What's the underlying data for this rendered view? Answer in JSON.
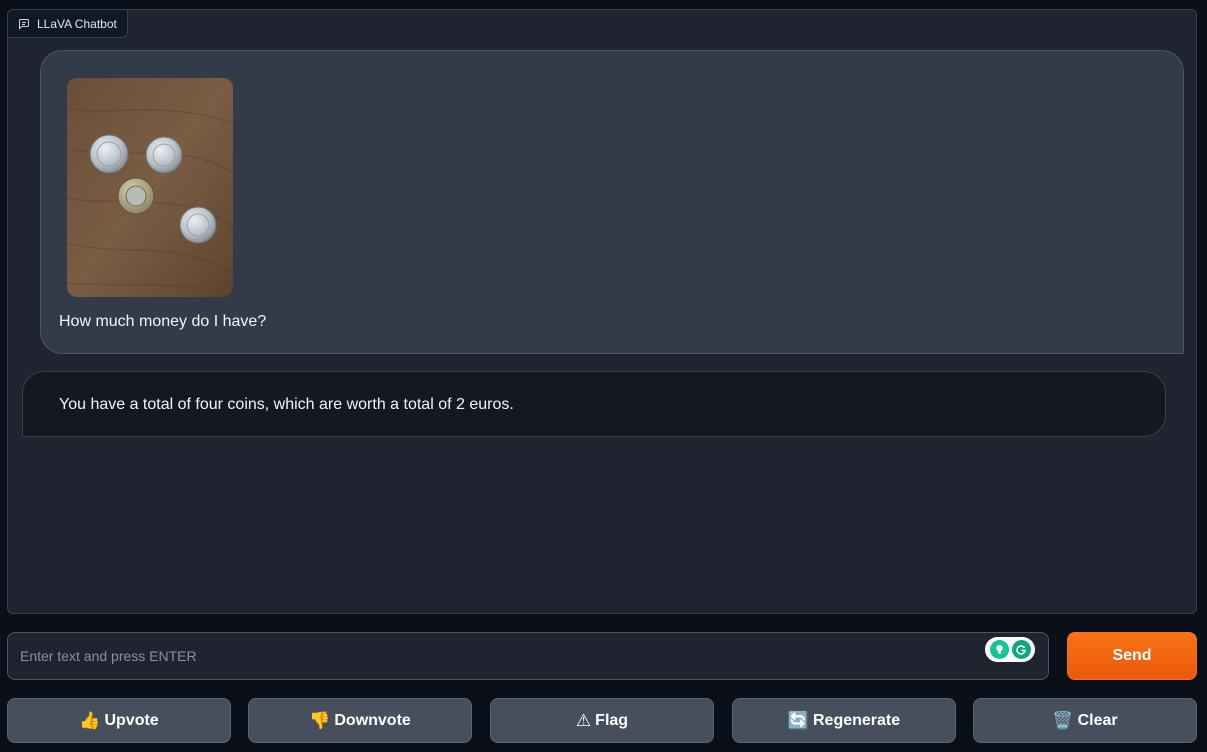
{
  "chatbot": {
    "label": "LLaVA Chatbot",
    "messages": {
      "user_text": "How much money do I have?",
      "bot_text": "You have a total of four coins, which are worth a total of 2 euros."
    }
  },
  "input": {
    "placeholder": "Enter text and press ENTER",
    "value": ""
  },
  "send_label": "Send",
  "actions": {
    "upvote": {
      "icon": "👍",
      "label": "Upvote"
    },
    "downvote": {
      "icon": "👎",
      "label": "Downvote"
    },
    "flag": {
      "icon": "⚠",
      "label": "Flag"
    },
    "regenerate": {
      "icon": "🔄",
      "label": "Regenerate"
    },
    "clear": {
      "icon": "🗑️",
      "label": "Clear"
    }
  },
  "colors": {
    "accent": "#f97316",
    "background": "#0b0f19",
    "panel": "#1f2430"
  }
}
